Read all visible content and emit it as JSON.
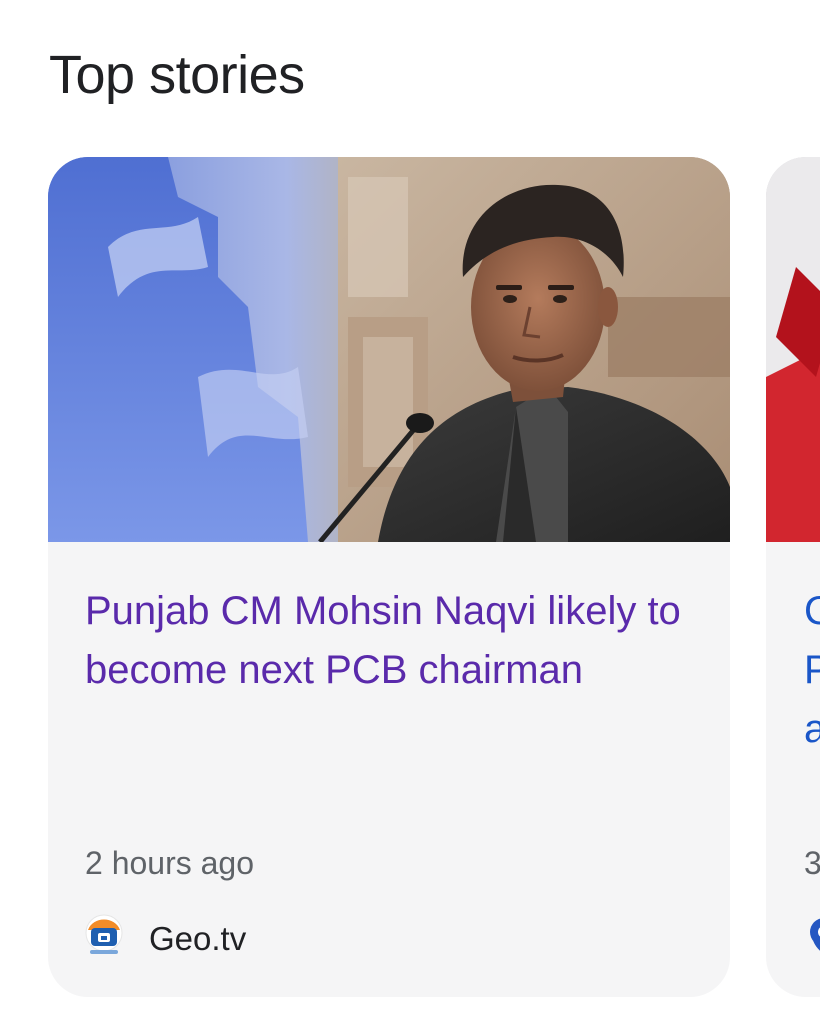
{
  "section": {
    "title": "Top stories"
  },
  "cards": [
    {
      "headline": "Punjab CM Mohsin Naqvi likely to become next PCB chairman",
      "time": "2 hours ago",
      "source": "Geo.tv",
      "source_logo_icon": "geo-tv-logo-icon",
      "headline_color": "#5a2aab"
    },
    {
      "headline_partial": "C\nP\na",
      "time_partial": "3",
      "headline_color": "#1a56c8"
    }
  ],
  "colors": {
    "card_background": "#f5f5f6",
    "title_text": "#202124",
    "meta_text": "#5f6368",
    "visited_link": "#5a2aab",
    "link": "#1a56c8"
  }
}
